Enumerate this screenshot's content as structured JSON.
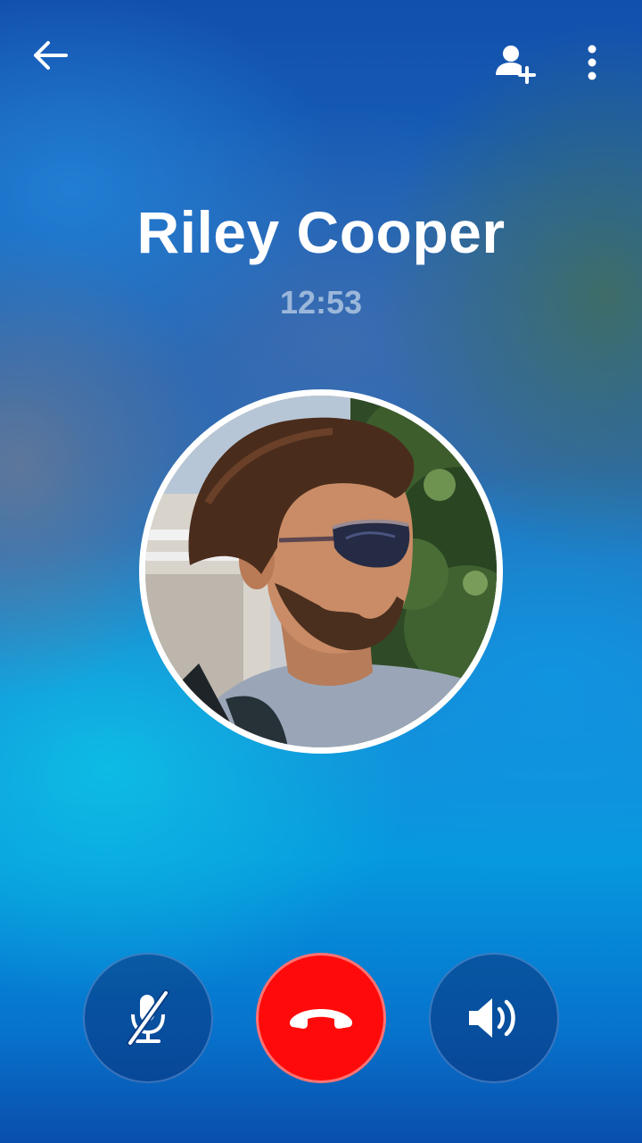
{
  "call": {
    "contact_name": "Riley Cooper",
    "duration": "12:53"
  },
  "topbar": {
    "back_icon": "arrow-left-icon",
    "add_participant_icon": "person-add-icon",
    "more_icon": "more-vertical-icon"
  },
  "controls": {
    "mute_icon": "microphone-off-icon",
    "end_call_icon": "phone-hangup-icon",
    "speaker_icon": "speaker-volume-icon",
    "end_call_color": "#ff0a0a"
  }
}
